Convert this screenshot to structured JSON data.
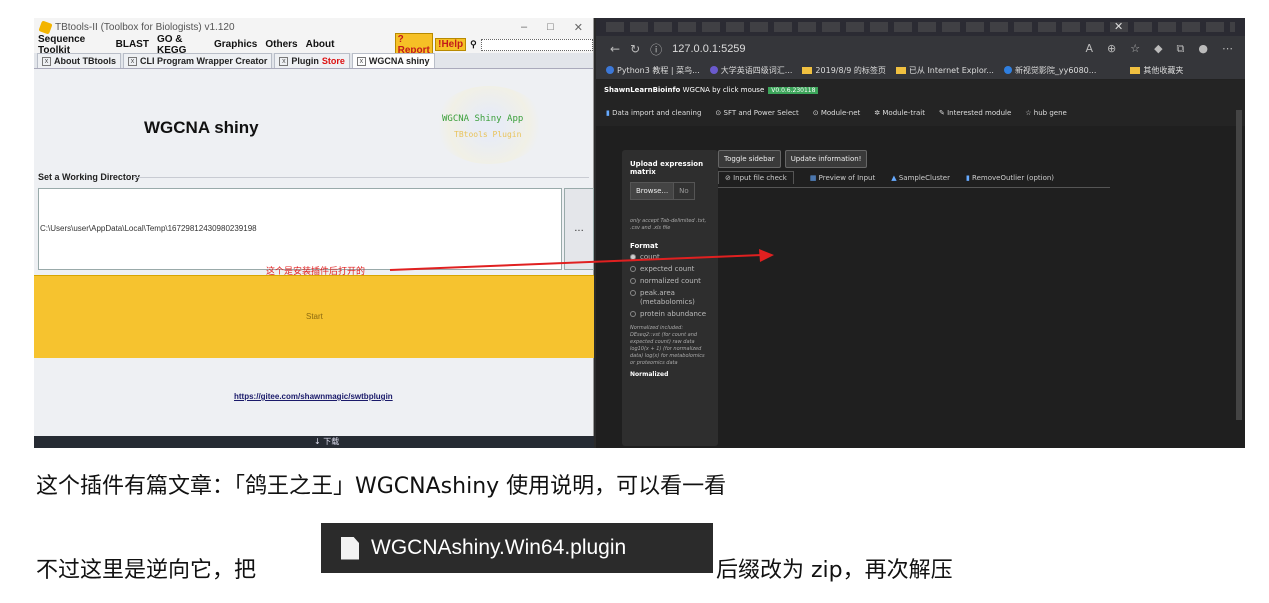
{
  "tbtools": {
    "window_title": "TBtools-II (Toolbox for Biologists) v1.120",
    "menu": [
      "Sequence Toolkit",
      "BLAST",
      "GO & KEGG",
      "Graphics",
      "Others",
      "About"
    ],
    "report_label": "?Report",
    "help_label": "!Help",
    "tabs": [
      {
        "label": "About TBtools"
      },
      {
        "label": "CLI Program Wrapper Creator"
      },
      {
        "label": "Plugin ",
        "suffix": "Store"
      },
      {
        "label": "WGCNA shiny"
      }
    ],
    "plugin_title": "WGCNA shiny",
    "logo_text_1": "WGCNA Shiny App",
    "logo_text_2": "TBtools Plugin",
    "working_dir_label": "Set a Working Directory",
    "working_dir_value": "C:\\Users\\user\\AppData\\Local\\Temp\\16729812430980239198",
    "dir_button": "...",
    "annotation": "这个是安装插件后打开的",
    "start_label": "Start",
    "link": "https://gitee.com/shawnmagic/swtbplugin",
    "taskbar_download": "↓ 下载"
  },
  "browser": {
    "url": "127.0.0.1:5259",
    "bookmarks": [
      "Python3 教程 | 菜鸟...",
      "大学英语四级词汇...",
      "2019/8/9 的标签页",
      "已从 Internet Explor...",
      "新视觉影院_yy6080...",
      "其他收藏夹"
    ],
    "app_brand": "ShawnLearnBioinfo",
    "app_name": "WGCNA by click mouse",
    "app_version": "V0.0.6.230118",
    "nav": [
      "Data import and cleaning",
      "SFT and Power Select",
      "Module-net",
      "Module-trait",
      "Interested module",
      "hub gene"
    ],
    "sidebar": {
      "heading": "Upload expression matrix",
      "browse": "Browse...",
      "no_file": "No",
      "note": "only accept Tab-delimited .txt, .csv and .xls file",
      "format_label": "Format",
      "options": [
        "count",
        "expected count",
        "normalized count",
        "peak.area (metabolomics)",
        "protein abundance"
      ],
      "selected": "count",
      "norm_note": "Normalized included: DEseq2::vst (for count and expected count) raw data log10(x + 1) (for normalized data) log(x) for metabolomics or proteomics data",
      "norm_heading": "Normalized"
    },
    "buttons": [
      "Toggle sidebar",
      "Update information!"
    ],
    "tabs": [
      "Input file check",
      "Preview of Input",
      "SampleCluster",
      "RemoveOutlier (option)"
    ],
    "active_tab": "Input file check"
  },
  "article": {
    "para1": "这个插件有篇文章：「鸽王之王」WGCNAshiny 使用说明，可以看一看",
    "para2_before": "不过这里是逆向它，把",
    "file_chip": "WGCNAshiny.Win64.plugin",
    "para2_after": "后缀改为 zip，再次解压"
  },
  "colors": {
    "start_panel": "#f6c32f",
    "annotation_red": "#e02020",
    "version_badge": "#3ca55a",
    "file_chip_bg": "#2b2b2b"
  }
}
